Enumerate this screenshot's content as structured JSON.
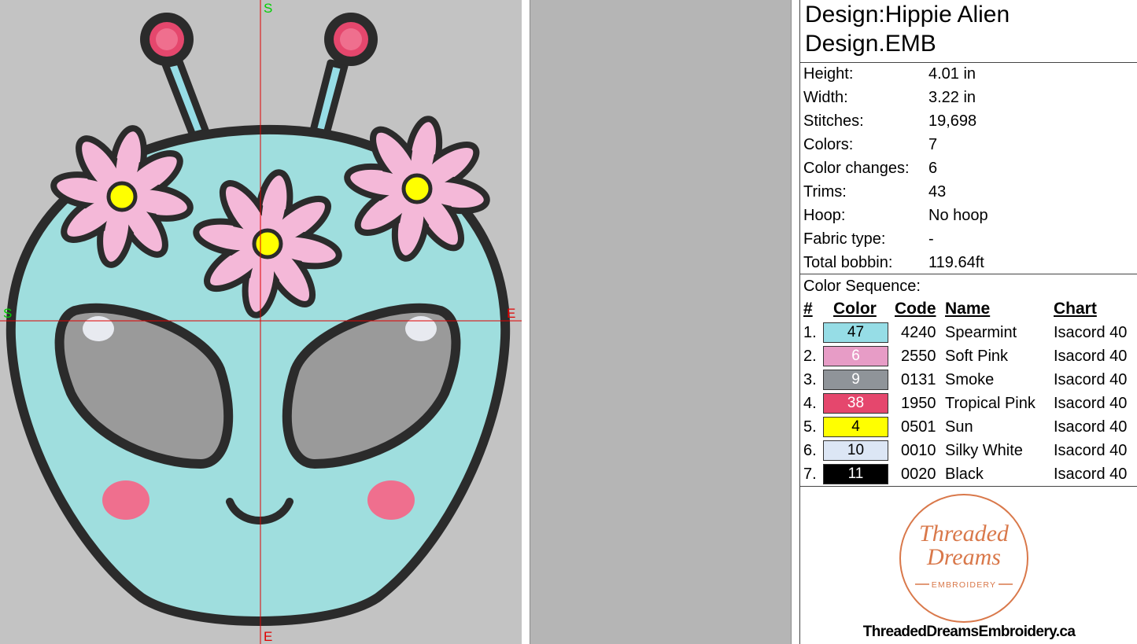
{
  "preview": {
    "axis_labels": {
      "top": "S",
      "bottom": "E",
      "left": "S",
      "right": "E"
    }
  },
  "design": {
    "title_line1": "Design:Hippie Alien",
    "title_line2": "Design.EMB"
  },
  "stats": [
    {
      "label": "Height:",
      "value": "4.01 in"
    },
    {
      "label": "Width:",
      "value": "3.22 in"
    },
    {
      "label": "Stitches:",
      "value": "19,698"
    },
    {
      "label": "Colors:",
      "value": "7"
    },
    {
      "label": "Color changes:",
      "value": "6"
    },
    {
      "label": "Trims:",
      "value": "43"
    },
    {
      "label": "Hoop:",
      "value": "No hoop"
    },
    {
      "label": "Fabric type:",
      "value": "-"
    },
    {
      "label": "Total bobbin:",
      "value": "119.64ft"
    }
  ],
  "color_sequence": {
    "label": "Color Sequence:",
    "headers": {
      "num": "#",
      "color": "Color",
      "code": "Code",
      "name": "Name",
      "chart": "Chart"
    },
    "rows": [
      {
        "num": "1.",
        "swatch": "47",
        "hex": "#96dde6",
        "text_color": "#000000",
        "code": "4240",
        "name": "Spearmint",
        "chart": "Isacord 40"
      },
      {
        "num": "2.",
        "swatch": "6",
        "hex": "#e79cc6",
        "text_color": "#ffffff",
        "code": "2550",
        "name": "Soft Pink",
        "chart": "Isacord 40"
      },
      {
        "num": "3.",
        "swatch": "9",
        "hex": "#8f9499",
        "text_color": "#ffffff",
        "code": "0131",
        "name": "Smoke",
        "chart": "Isacord 40"
      },
      {
        "num": "4.",
        "swatch": "38",
        "hex": "#e5476d",
        "text_color": "#ffffff",
        "code": "1950",
        "name": "Tropical Pink",
        "chart": "Isacord 40"
      },
      {
        "num": "5.",
        "swatch": "4",
        "hex": "#ffff00",
        "text_color": "#000000",
        "code": "0501",
        "name": "Sun",
        "chart": "Isacord 40"
      },
      {
        "num": "6.",
        "swatch": "10",
        "hex": "#dce6f5",
        "text_color": "#000000",
        "code": "0010",
        "name": "Silky White",
        "chart": "Isacord 40"
      },
      {
        "num": "7.",
        "swatch": "11",
        "hex": "#000000",
        "text_color": "#ffffff",
        "code": "0020",
        "name": "Black",
        "chart": "Isacord 40"
      }
    ]
  },
  "logo": {
    "line1": "Threaded",
    "line2": "Dreams",
    "line3": "EMBROIDERY",
    "color": "#d9784a"
  },
  "site_url": "ThreadedDreamsEmbroidery.ca"
}
